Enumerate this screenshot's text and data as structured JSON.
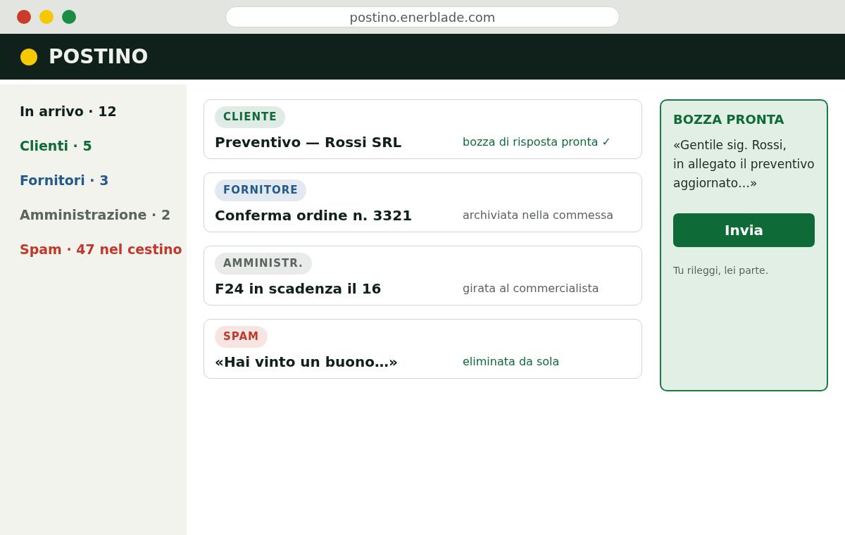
{
  "browser": {
    "url": "postino.enerblade.com"
  },
  "header": {
    "title": "POSTINO"
  },
  "sidebar": {
    "items": [
      {
        "label": "In arrivo · 12",
        "color": "#10201a"
      },
      {
        "label": "Clienti · 5",
        "color": "#0e6b38"
      },
      {
        "label": "Fornitori · 3",
        "color": "#245a8c"
      },
      {
        "label": "Amministrazione · 2",
        "color": "#5c645e"
      },
      {
        "label": "Spam · 47 nel cestino",
        "color": "#c0392b"
      }
    ]
  },
  "mails": [
    {
      "tag": {
        "label": "CLIENTE",
        "color": "#0e6b38"
      },
      "subject": "Preventivo — Rossi SRL",
      "status": {
        "text": "bozza di risposta pronta ✓",
        "color": "#0e6b38"
      }
    },
    {
      "tag": {
        "label": "FORNITORE",
        "color": "#245a8c"
      },
      "subject": "Conferma ordine n. 3321",
      "status": {
        "text": "archiviata nella commessa",
        "color": "#5c645e"
      }
    },
    {
      "tag": {
        "label": "AMMINISTR.",
        "color": "#5c645e"
      },
      "subject": "F24 in scadenza il 16",
      "status": {
        "text": "girata al commercialista",
        "color": "#5c645e"
      }
    },
    {
      "tag": {
        "label": "SPAM",
        "color": "#c0392b"
      },
      "subject": "«Hai vinto un buono…»",
      "status": {
        "text": "eliminata da sola",
        "color": "#0e6b38"
      }
    }
  ],
  "draft_panel": {
    "title": "BOZZA PRONTA",
    "text": "«Gentile sig. Rossi,\nin allegato il preventivo\naggiornato…»",
    "button": "Invia",
    "note": "Tu rileggi, lei parte."
  }
}
